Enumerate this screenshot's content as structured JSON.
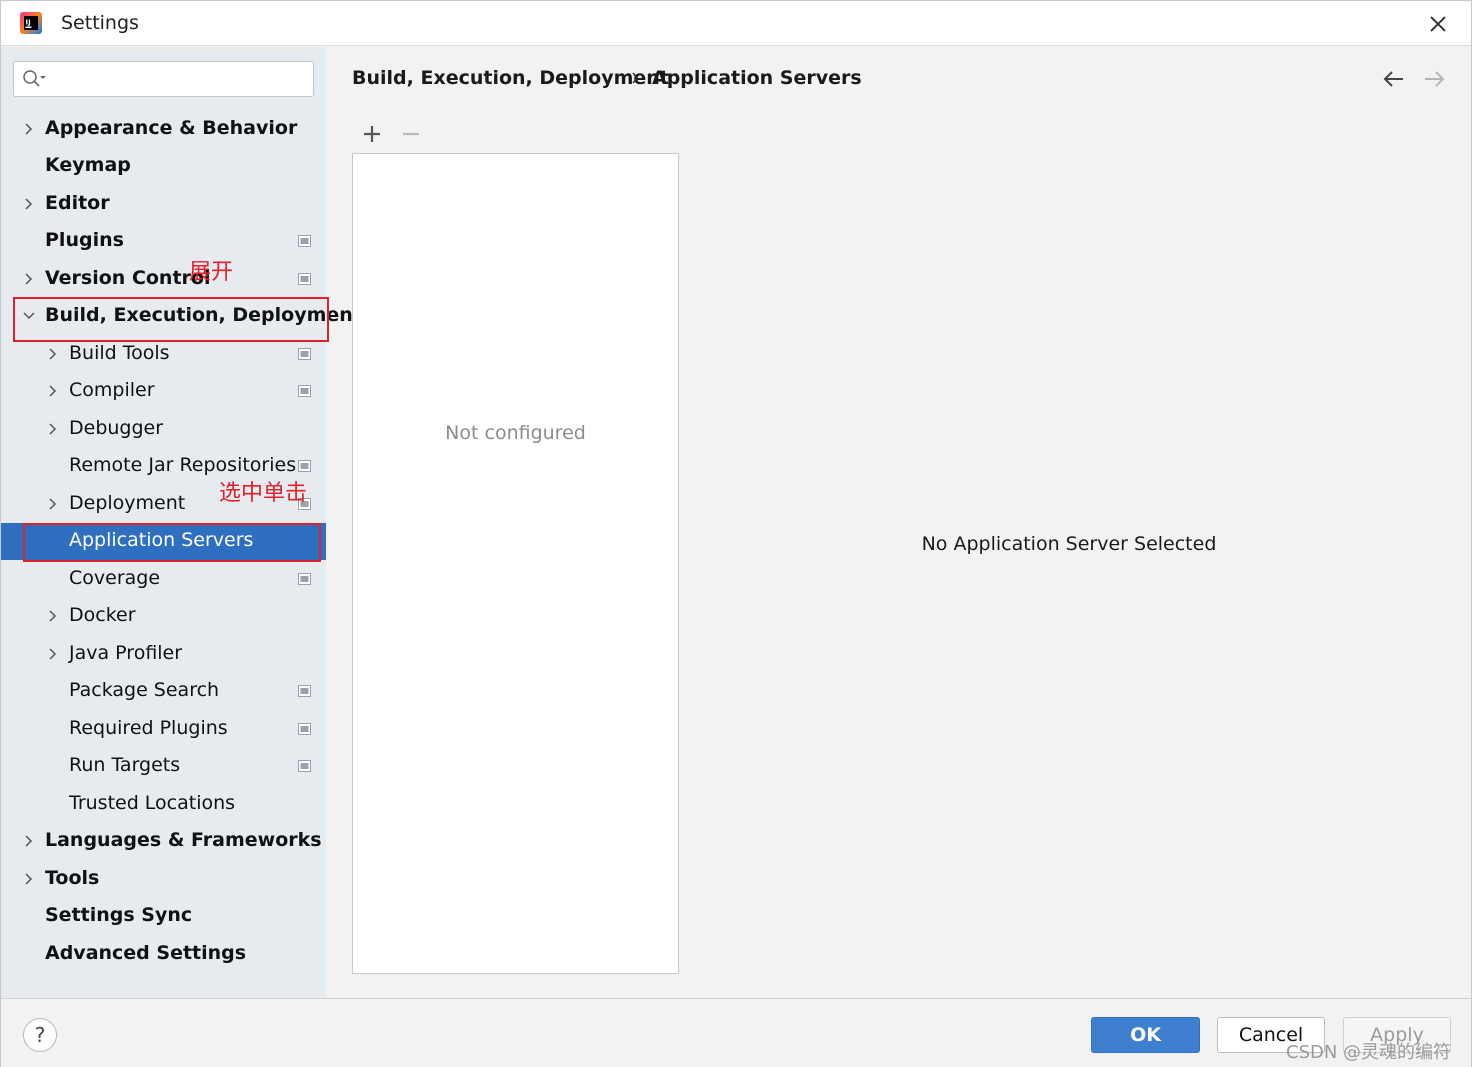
{
  "window": {
    "title": "Settings"
  },
  "sidebar": {
    "search": {
      "value": "",
      "placeholder": ""
    },
    "items": [
      {
        "label": "Appearance & Behavior",
        "bold": true,
        "level": 0,
        "expandable": true,
        "expanded": false,
        "project_badge": false
      },
      {
        "label": "Keymap",
        "bold": true,
        "level": 0,
        "expandable": false,
        "project_badge": false
      },
      {
        "label": "Editor",
        "bold": true,
        "level": 0,
        "expandable": true,
        "expanded": false,
        "project_badge": false
      },
      {
        "label": "Plugins",
        "bold": true,
        "level": 0,
        "expandable": false,
        "project_badge": true
      },
      {
        "label": "Version Control",
        "bold": true,
        "level": 0,
        "expandable": true,
        "expanded": false,
        "project_badge": true
      },
      {
        "label": "Build, Execution, Deployment",
        "bold": true,
        "level": 0,
        "expandable": true,
        "expanded": true,
        "project_badge": false
      },
      {
        "label": "Build Tools",
        "bold": false,
        "level": 1,
        "expandable": true,
        "expanded": false,
        "project_badge": true
      },
      {
        "label": "Compiler",
        "bold": false,
        "level": 1,
        "expandable": true,
        "expanded": false,
        "project_badge": true
      },
      {
        "label": "Debugger",
        "bold": false,
        "level": 1,
        "expandable": true,
        "expanded": false,
        "project_badge": false
      },
      {
        "label": "Remote Jar Repositories",
        "bold": false,
        "level": 1,
        "expandable": false,
        "project_badge": true
      },
      {
        "label": "Deployment",
        "bold": false,
        "level": 1,
        "expandable": true,
        "expanded": false,
        "project_badge": true
      },
      {
        "label": "Application Servers",
        "bold": false,
        "level": 1,
        "expandable": false,
        "selected": true,
        "project_badge": false
      },
      {
        "label": "Coverage",
        "bold": false,
        "level": 1,
        "expandable": false,
        "project_badge": true
      },
      {
        "label": "Docker",
        "bold": false,
        "level": 1,
        "expandable": true,
        "expanded": false,
        "project_badge": false
      },
      {
        "label": "Java Profiler",
        "bold": false,
        "level": 1,
        "expandable": true,
        "expanded": false,
        "project_badge": false
      },
      {
        "label": "Package Search",
        "bold": false,
        "level": 1,
        "expandable": false,
        "project_badge": true
      },
      {
        "label": "Required Plugins",
        "bold": false,
        "level": 1,
        "expandable": false,
        "project_badge": true
      },
      {
        "label": "Run Targets",
        "bold": false,
        "level": 1,
        "expandable": false,
        "project_badge": true
      },
      {
        "label": "Trusted Locations",
        "bold": false,
        "level": 1,
        "expandable": false,
        "project_badge": false
      },
      {
        "label": "Languages & Frameworks",
        "bold": true,
        "level": 0,
        "expandable": true,
        "expanded": false,
        "project_badge": false
      },
      {
        "label": "Tools",
        "bold": true,
        "level": 0,
        "expandable": true,
        "expanded": false,
        "project_badge": false
      },
      {
        "label": "Settings Sync",
        "bold": true,
        "level": 0,
        "expandable": false,
        "project_badge": false
      },
      {
        "label": "Advanced Settings",
        "bold": true,
        "level": 0,
        "expandable": false,
        "project_badge": false
      }
    ]
  },
  "annotations": {
    "expand_note": "展开",
    "click_note": "选中单击"
  },
  "main": {
    "breadcrumb": {
      "parent": "Build, Execution, Deployment",
      "current": "Application Servers"
    },
    "toolbar": {
      "add": "+",
      "remove": "−"
    },
    "server_list": {
      "empty_text": "Not configured"
    },
    "detail": {
      "empty_text": "No Application Server Selected"
    }
  },
  "footer": {
    "help_label": "?",
    "ok_label": "OK",
    "cancel_label": "Cancel",
    "apply_label": "Apply"
  },
  "watermark": "CSDN @灵魂的编符",
  "colors": {
    "selection": "#2f6fc0",
    "annotation_red": "#e0202a",
    "ok_button": "#3f7fd0",
    "sidebar_bg": "#e6ebf0"
  }
}
